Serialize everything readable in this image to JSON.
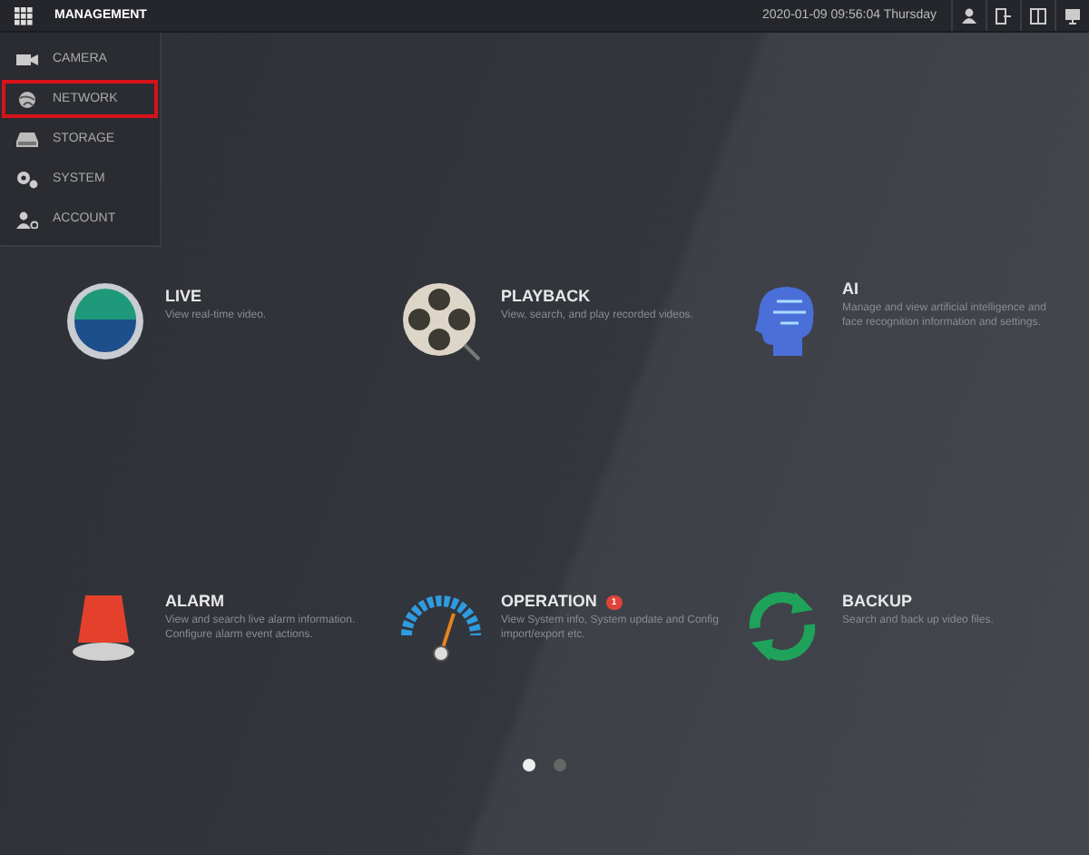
{
  "topbar": {
    "title": "MANAGEMENT",
    "datetime": "2020-01-09 09:56:04 Thursday"
  },
  "menu": [
    {
      "label": "CAMERA",
      "kind": "camera",
      "selected": false
    },
    {
      "label": "NETWORK",
      "kind": "network",
      "selected": true
    },
    {
      "label": "STORAGE",
      "kind": "storage",
      "selected": false
    },
    {
      "label": "SYSTEM",
      "kind": "system",
      "selected": false
    },
    {
      "label": "ACCOUNT",
      "kind": "account",
      "selected": false
    }
  ],
  "tiles": [
    {
      "kind": "live",
      "title": "LIVE",
      "description": "View real-time video."
    },
    {
      "kind": "playback",
      "title": "PLAYBACK",
      "description": "View, search, and play recorded videos."
    },
    {
      "kind": "ai",
      "title": "AI",
      "description": "Manage and view artificial intelligence and face recognition information and settings."
    },
    {
      "kind": "alarm",
      "title": "ALARM",
      "description": "View and search live alarm information. Configure alarm event actions."
    },
    {
      "kind": "operation",
      "title": "OPERATION",
      "badge": "1",
      "description": "View System info, System update and Config import/export etc."
    },
    {
      "kind": "backup",
      "title": "BACKUP",
      "description": "Search and back up video files."
    }
  ],
  "pages": [
    {
      "selected": true
    },
    {
      "selected": false
    }
  ]
}
